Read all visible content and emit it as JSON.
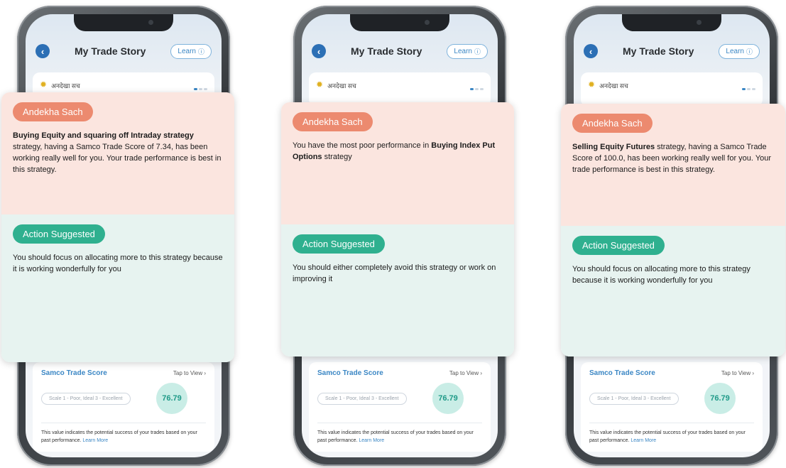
{
  "phones": [
    {
      "header": {
        "title": "My Trade Story",
        "learn_label": "Learn",
        "back_icon": "back-arrow-icon"
      },
      "strip": {
        "label": "अनदेखा सच"
      },
      "card": {
        "badge": "Andekha Sach",
        "message_bold": "Buying Equity and squaring off Intraday strategy",
        "message_rest": " strategy, having a Samco Trade Score of 7.34, has been working really well for you. Your trade performance is best in this strategy.",
        "action_badge": "Action Suggested",
        "action_text": "You should focus on allocating more to this strategy because it is working wonderfully for you"
      },
      "lower": {
        "sts_title": "Samco Trade Score",
        "tap_label": "Tap to View",
        "scale_label": "Scale 1 - Poor, Ideal 3 - Excellent",
        "score": "76.79",
        "desc": "This value indicates the potential success of your trades based on your past performance.",
        "learn_more": "Learn More"
      }
    },
    {
      "header": {
        "title": "My Trade Story",
        "learn_label": "Learn",
        "back_icon": "back-arrow-icon"
      },
      "strip": {
        "label": "अनदेखा सच"
      },
      "card": {
        "badge": "Andekha Sach",
        "message_pre": "You have the most poor performance in ",
        "message_bold": "Buying Index Put Options",
        "message_rest": " strategy",
        "action_badge": "Action Suggested",
        "action_text": "You should either completely avoid this strategy or work on improving it"
      },
      "lower": {
        "sts_title": "Samco Trade Score",
        "tap_label": "Tap to View",
        "scale_label": "Scale 1 - Poor, Ideal 3 - Excellent",
        "score": "76.79",
        "desc": "This value indicates the potential success of your trades based on your past performance.",
        "learn_more": "Learn More"
      }
    },
    {
      "header": {
        "title": "My Trade Story",
        "learn_label": "Learn",
        "back_icon": "back-arrow-icon"
      },
      "strip": {
        "label": "अनदेखा सच"
      },
      "card": {
        "badge": "Andekha Sach",
        "message_bold": "Selling Equity Futures",
        "message_rest": " strategy, having a Samco Trade Score of 100.0, has been working really well for you. Your trade performance is best in this strategy.",
        "action_badge": "Action Suggested",
        "action_text": "You should focus on allocating more to this strategy because it is working wonderfully for you"
      },
      "lower": {
        "sts_title": "Samco Trade Score",
        "tap_label": "Tap to View",
        "scale_label": "Scale 1 - Poor, Ideal 3 - Excellent",
        "score": "76.79",
        "desc": "This value indicates the potential success of your trades based on your past performance.",
        "learn_more": "Learn More"
      }
    }
  ],
  "colors": {
    "badge_sach": "#ec8a6f",
    "badge_action": "#2fb08f",
    "card_top_bg": "#fbe5df",
    "card_bottom_bg": "#e7f3f0",
    "accent_blue": "#3a86c4"
  }
}
